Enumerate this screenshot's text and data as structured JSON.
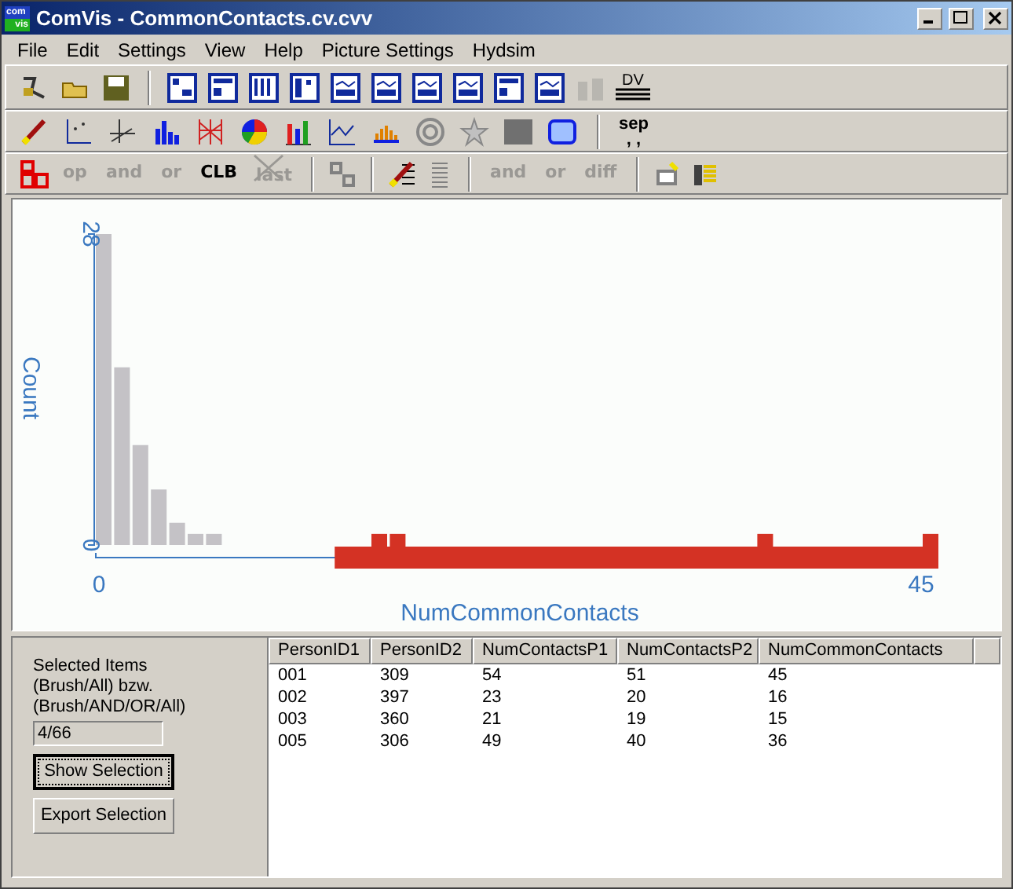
{
  "window": {
    "title": "ComVis - CommonContacts.cv.cvv",
    "logo_top": "com",
    "logo_bottom": "vis"
  },
  "menu": [
    "File",
    "Edit",
    "Settings",
    "View",
    "Help",
    "Picture Settings",
    "Hydsim"
  ],
  "toolbar": {
    "dv_label": "DV",
    "sep_label": "sep",
    "sep_dots": ", ,",
    "logic_buttons": [
      {
        "label": "op",
        "disabled": true
      },
      {
        "label": "and",
        "disabled": true
      },
      {
        "label": "or",
        "disabled": true
      },
      {
        "label": "CLB",
        "disabled": false
      },
      {
        "label": "last",
        "disabled": true
      }
    ],
    "set_buttons": [
      {
        "label": "and",
        "disabled": true
      },
      {
        "label": "or",
        "disabled": true
      },
      {
        "label": "diff",
        "disabled": true
      }
    ]
  },
  "chart": {
    "chart_data": {
      "type": "bar",
      "xlabel": "NumCommonContacts",
      "ylabel": "Count",
      "x": [
        0,
        1,
        2,
        3,
        4,
        5,
        6,
        15,
        16,
        36,
        45
      ],
      "xlim": [
        0,
        45
      ],
      "ylim": [
        0,
        28
      ],
      "xticks": [
        0,
        45
      ],
      "yticks": [
        0,
        28
      ],
      "series": [
        {
          "color": "#c4c2c6",
          "values": [
            28,
            16,
            9,
            5,
            2,
            1,
            1,
            null,
            null,
            null,
            null
          ]
        },
        {
          "color": "#d43224",
          "values": [
            null,
            null,
            null,
            null,
            null,
            null,
            null,
            1,
            1,
            1,
            1
          ]
        }
      ]
    }
  },
  "selection": {
    "label_lines": [
      "Selected Items",
      "(Brush/All) bzw.",
      "(Brush/AND/OR/All)"
    ],
    "count": "4/66",
    "buttons": [
      {
        "label": "Show Selection",
        "focused": true
      },
      {
        "label": "Export Selection",
        "focused": false
      }
    ]
  },
  "table": {
    "columns": [
      "PersonID1",
      "PersonID2",
      "NumContactsP1",
      "NumContactsP2",
      "NumCommonContacts"
    ],
    "rows": [
      [
        "001",
        "309",
        "54",
        "51",
        "45"
      ],
      [
        "002",
        "397",
        "23",
        "20",
        "16"
      ],
      [
        "003",
        "360",
        "21",
        "19",
        "15"
      ],
      [
        "005",
        "306",
        "49",
        "40",
        "36"
      ]
    ]
  }
}
